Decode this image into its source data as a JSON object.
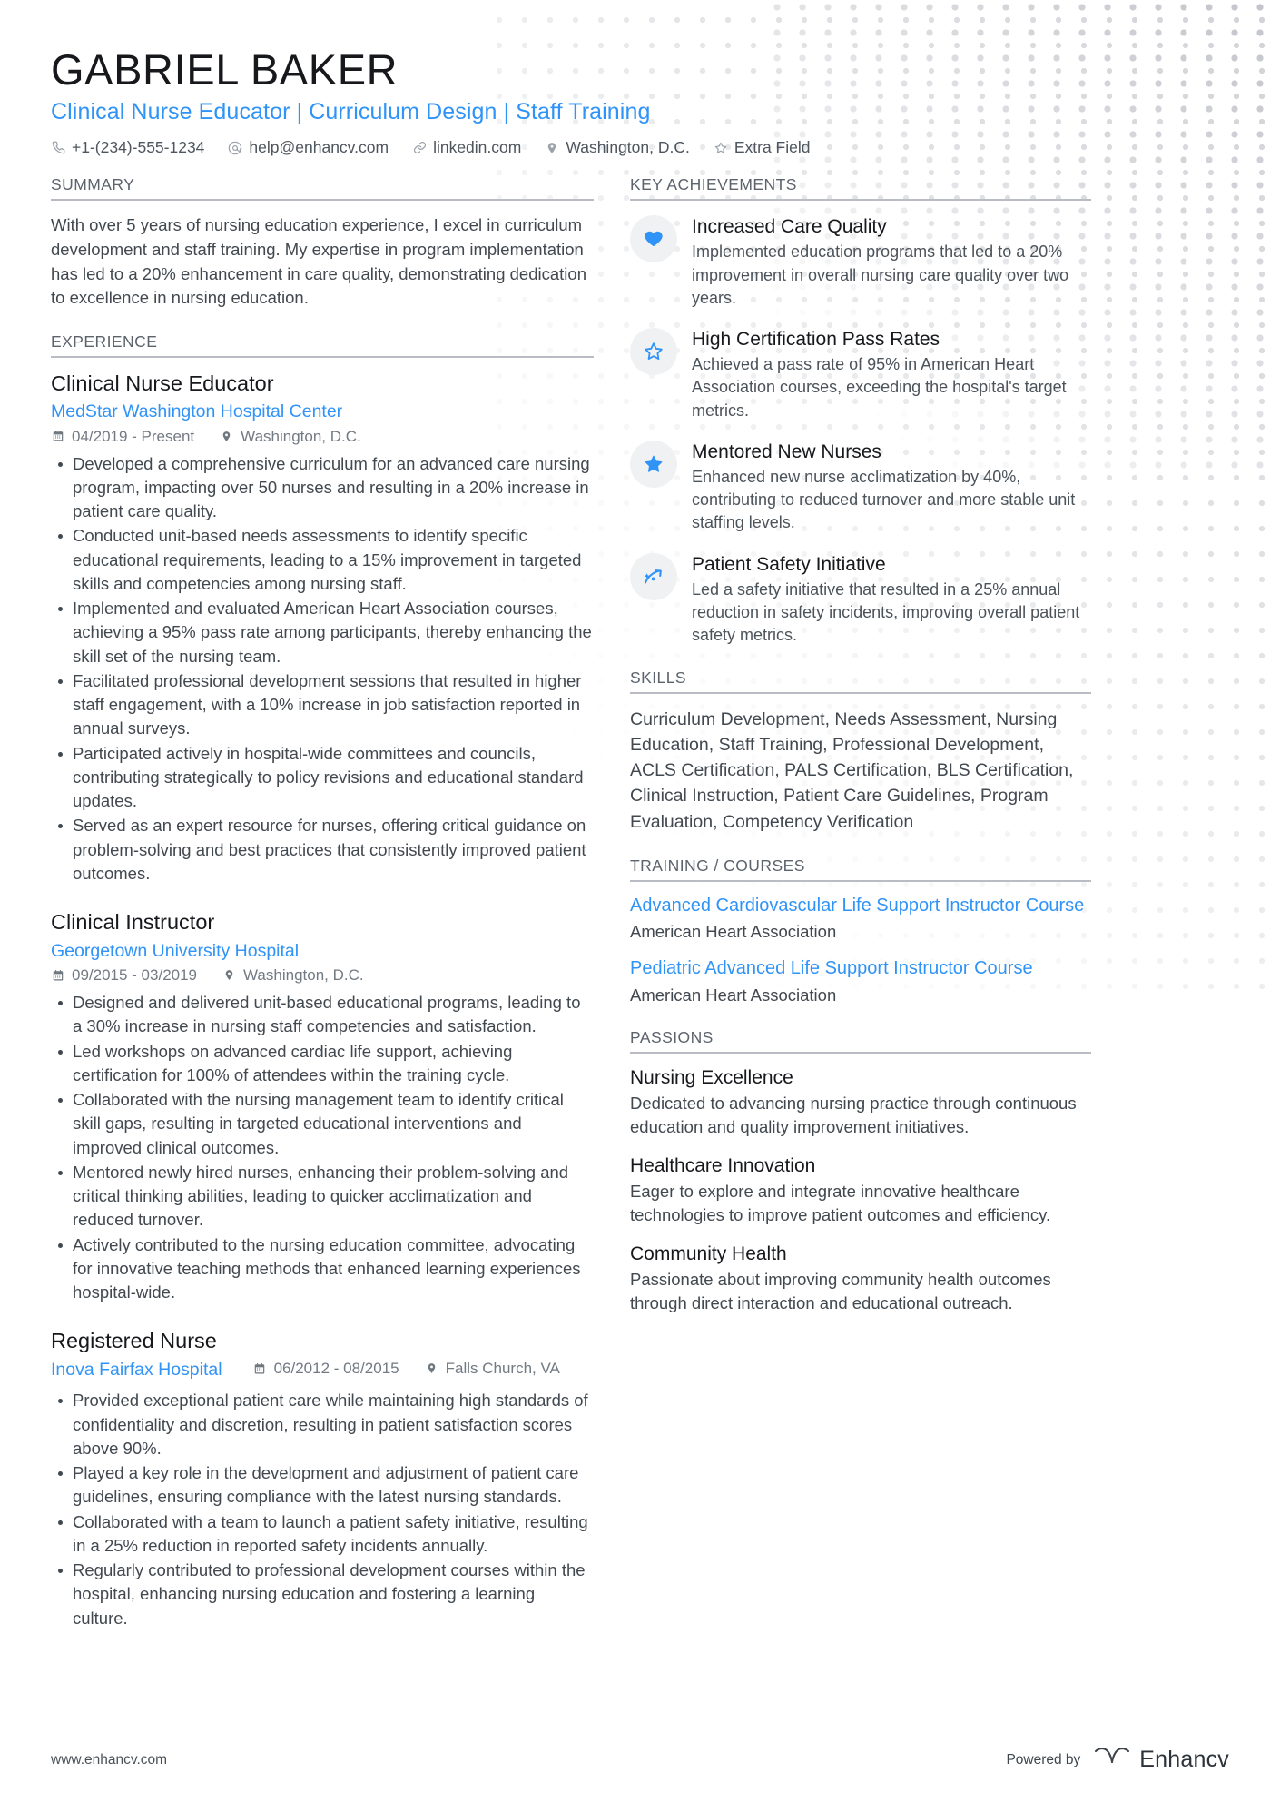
{
  "colors": {
    "accent": "#2f93f7",
    "name": "#16181c",
    "body": "#41484f",
    "muted": "#727a83",
    "rule": "#b9bcc2",
    "icon_bubble": "#f0f1f2"
  },
  "header": {
    "name": "GABRIEL BAKER",
    "headline": "Clinical Nurse Educator | Curriculum Design | Staff Training",
    "contacts": [
      {
        "icon": "phone-icon",
        "text": "+1-(234)-555-1234"
      },
      {
        "icon": "email-icon",
        "text": "help@enhancv.com"
      },
      {
        "icon": "link-icon",
        "text": "linkedin.com"
      },
      {
        "icon": "location-pin-icon",
        "text": "Washington, D.C."
      },
      {
        "icon": "star-outline-icon",
        "text": "Extra Field"
      }
    ]
  },
  "left": {
    "summary": {
      "heading": "SUMMARY",
      "text": "With over 5 years of nursing education experience, I excel in curriculum development and staff training. My expertise in program implementation has led to a 20% enhancement in care quality, demonstrating dedication to excellence in nursing education."
    },
    "experience": {
      "heading": "EXPERIENCE",
      "jobs": [
        {
          "title": "Clinical Nurse Educator",
          "company": "MedStar Washington Hospital Center",
          "dates": "04/2019 - Present",
          "location": "Washington, D.C.",
          "inline_meta": false,
          "bullets": [
            "Developed a comprehensive curriculum for an advanced care nursing program, impacting over 50 nurses and resulting in a 20% increase in patient care quality.",
            "Conducted unit-based needs assessments to identify specific educational requirements, leading to a 15% improvement in targeted skills and competencies among nursing staff.",
            "Implemented and evaluated American Heart Association courses, achieving a 95% pass rate among participants, thereby enhancing the skill set of the nursing team.",
            "Facilitated professional development sessions that resulted in higher staff engagement, with a 10% increase in job satisfaction reported in annual surveys.",
            "Participated actively in hospital-wide committees and councils, contributing strategically to policy revisions and educational standard updates.",
            "Served as an expert resource for nurses, offering critical guidance on problem-solving and best practices that consistently improved patient outcomes."
          ]
        },
        {
          "title": "Clinical Instructor",
          "company": "Georgetown University Hospital",
          "dates": "09/2015 - 03/2019",
          "location": "Washington, D.C.",
          "inline_meta": false,
          "bullets": [
            "Designed and delivered unit-based educational programs, leading to a 30% increase in nursing staff competencies and satisfaction.",
            "Led workshops on advanced cardiac life support, achieving certification for 100% of attendees within the training cycle.",
            "Collaborated with the nursing management team to identify critical skill gaps, resulting in targeted educational interventions and improved clinical outcomes.",
            "Mentored newly hired nurses, enhancing their problem-solving and critical thinking abilities, leading to quicker acclimatization and reduced turnover.",
            "Actively contributed to the nursing education committee, advocating for innovative teaching methods that enhanced learning experiences hospital-wide."
          ]
        },
        {
          "title": "Registered Nurse",
          "company": "Inova Fairfax Hospital",
          "dates": "06/2012 - 08/2015",
          "location": "Falls Church, VA",
          "inline_meta": true,
          "bullets": [
            "Provided exceptional patient care while maintaining high standards of confidentiality and discretion, resulting in patient satisfaction scores above 90%.",
            "Played a key role in the development and adjustment of patient care guidelines, ensuring compliance with the latest nursing standards.",
            "Collaborated with a team to launch a patient safety initiative, resulting in a 25% reduction in reported safety incidents annually.",
            "Regularly contributed to professional development courses within the hospital, enhancing nursing education and fostering a learning culture."
          ]
        }
      ]
    }
  },
  "right": {
    "achievements": {
      "heading": "KEY ACHIEVEMENTS",
      "items": [
        {
          "icon": "heart-icon",
          "title": "Increased Care Quality",
          "desc": "Implemented education programs that led to a 20% improvement in overall nursing care quality over two years."
        },
        {
          "icon": "star-outline-icon",
          "title": "High Certification Pass Rates",
          "desc": "Achieved a pass rate of 95% in American Heart Association courses, exceeding the hospital's target metrics."
        },
        {
          "icon": "star-filled-icon",
          "title": "Mentored New Nurses",
          "desc": "Enhanced new nurse acclimatization by 40%, contributing to reduced turnover and more stable unit staffing levels."
        },
        {
          "icon": "trend-up-arrow-icon",
          "title": "Patient Safety Initiative",
          "desc": "Led a safety initiative that resulted in a 25% annual reduction in safety incidents, improving overall patient safety metrics."
        }
      ]
    },
    "skills": {
      "heading": "SKILLS",
      "text": "Curriculum Development, Needs Assessment, Nursing Education, Staff Training, Professional Development, ACLS Certification, PALS Certification, BLS Certification, Clinical Instruction, Patient Care Guidelines, Program Evaluation, Competency Verification"
    },
    "training": {
      "heading": "TRAINING / COURSES",
      "courses": [
        {
          "title": "Advanced Cardiovascular Life Support Instructor Course",
          "org": "American Heart Association"
        },
        {
          "title": "Pediatric Advanced Life Support Instructor Course",
          "org": "American Heart Association"
        }
      ]
    },
    "passions": {
      "heading": "PASSIONS",
      "items": [
        {
          "title": "Nursing Excellence",
          "desc": "Dedicated to advancing nursing practice through continuous education and quality improvement initiatives."
        },
        {
          "title": "Healthcare Innovation",
          "desc": "Eager to explore and integrate innovative healthcare technologies to improve patient outcomes and efficiency."
        },
        {
          "title": "Community Health",
          "desc": "Passionate about improving community health outcomes through direct interaction and educational outreach."
        }
      ]
    }
  },
  "footer": {
    "url": "www.enhancv.com",
    "powered_by": "Powered by",
    "brand": "Enhancv"
  }
}
